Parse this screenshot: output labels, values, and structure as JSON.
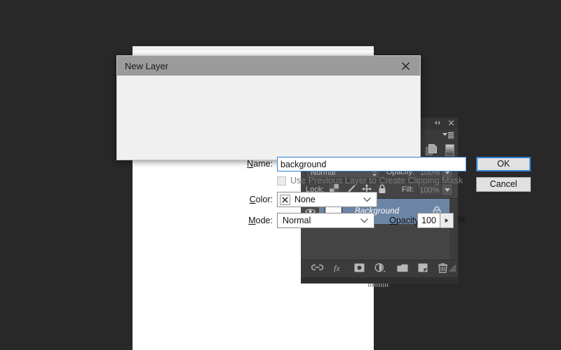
{
  "app": {
    "background_color": "#282828",
    "canvas_color": "#ffffff"
  },
  "dialog": {
    "title": "New Layer",
    "close_icon": "close-icon",
    "name_label": "Name:",
    "name_value": "background",
    "clipping_mask_label": "Use Previous Layer to Create Clipping Mask",
    "clipping_mask_checked": false,
    "color_label": "Color:",
    "color_value": "None",
    "color_swatch_icon": "x-swatch-icon",
    "mode_label": "Mode:",
    "mode_value": "Normal",
    "opacity_label": "Opacity:",
    "opacity_value": "100",
    "opacity_unit": "%",
    "ok_label": "OK",
    "cancel_label": "Cancel",
    "focus_color": "#2f7fd0"
  },
  "layers_panel": {
    "tabbar": {
      "collapse_icon": "collapse-double-arrow-icon",
      "close_icon": "close-icon"
    },
    "menu_icon": "panel-menu-icon",
    "toolstrip_icons": [
      "duplicate-layer-icon",
      "mask-gradient-icon"
    ],
    "blend_mode": "Normal",
    "opacity_label": "Opacity:",
    "opacity_value": "100%",
    "lock_label": "Lock:",
    "lock_icons": [
      "transparency-checker-icon",
      "paintbrush-icon",
      "move-arrows-icon",
      "lock-all-icon"
    ],
    "fill_label": "Fill:",
    "fill_value": "100%",
    "layers": [
      {
        "name": "Background",
        "visible": true,
        "locked": true,
        "selected": true,
        "visibility_icon": "eye-icon",
        "lock_icon": "lock-icon",
        "thumbnail_color": "#ffffff"
      }
    ],
    "selection_color": "#6d85a5",
    "bottom_icons": [
      "link-layers-icon",
      "fx-layer-style-icon",
      "add-layer-mask-icon",
      "adjustment-layer-icon",
      "new-group-icon",
      "new-layer-icon",
      "delete-layer-icon"
    ],
    "resize_grip_icon": "resize-grip-icon"
  }
}
